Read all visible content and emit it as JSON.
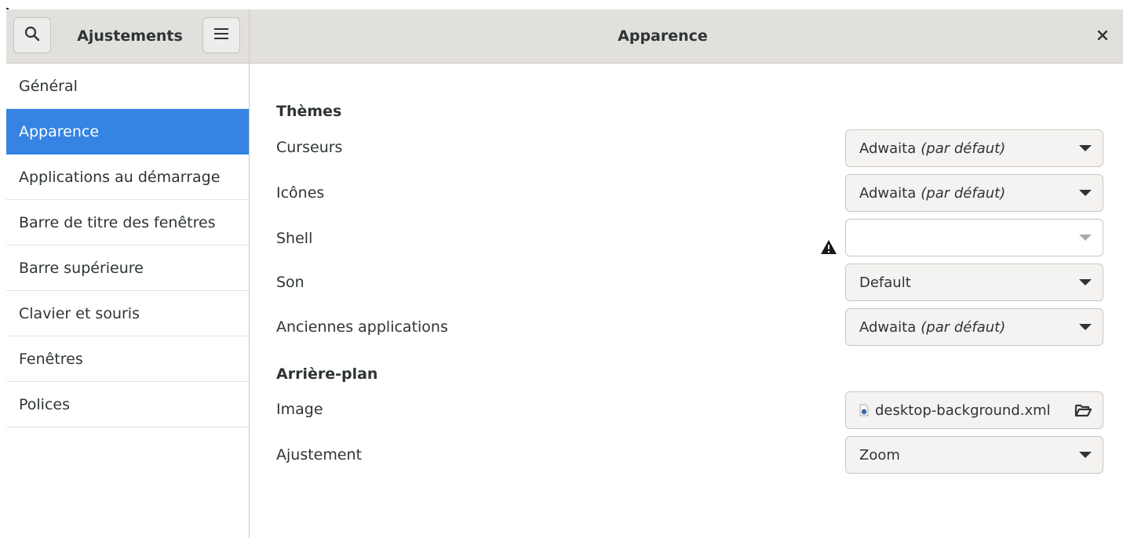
{
  "header": {
    "sidebar_title": "Ajustements",
    "page_title": "Apparence"
  },
  "icons": {
    "search": "search-icon",
    "menu": "hamburger-menu-icon",
    "close": "close-icon",
    "warning": "warning-icon",
    "file": "xml-file-icon",
    "folder": "folder-open-icon"
  },
  "colors": {
    "accent": "#3584e4",
    "header_bg": "#e2e0dd",
    "text": "#2e3436"
  },
  "sidebar": {
    "items": [
      {
        "label": "Général"
      },
      {
        "label": "Apparence",
        "selected": true
      },
      {
        "label": "Applications au démarrage"
      },
      {
        "label": "Barre de titre des fenêtres"
      },
      {
        "label": "Barre supérieure"
      },
      {
        "label": "Clavier et souris"
      },
      {
        "label": "Fenêtres"
      },
      {
        "label": "Polices"
      }
    ]
  },
  "main": {
    "themes_header": "Thèmes",
    "rows": {
      "cursors": {
        "label": "Curseurs",
        "value": "Adwaita",
        "hint": "(par défaut)"
      },
      "icons": {
        "label": "Icônes",
        "value": "Adwaita",
        "hint": "(par défaut)"
      },
      "shell": {
        "label": "Shell",
        "value": ""
      },
      "sound": {
        "label": "Son",
        "value": "Default"
      },
      "legacy": {
        "label": "Anciennes applications",
        "value": "Adwaita",
        "hint": "(par défaut)"
      }
    },
    "background_header": "Arrière-plan",
    "background": {
      "image": {
        "label": "Image",
        "value": "desktop-background.xml"
      },
      "adjustment": {
        "label": "Ajustement",
        "value": "Zoom"
      }
    }
  }
}
